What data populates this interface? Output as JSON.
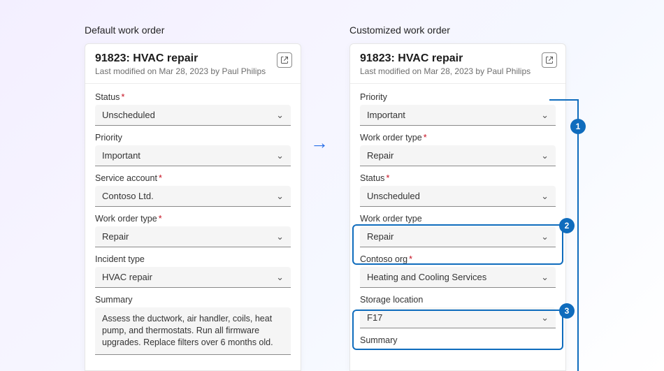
{
  "left": {
    "heading": "Default work order",
    "card": {
      "title": "91823: HVAC repair",
      "subtitle": "Last modified on Mar 28, 2023 by Paul Philips"
    },
    "fields": {
      "status": {
        "label": "Status",
        "required": true,
        "value": "Unscheduled"
      },
      "priority": {
        "label": "Priority",
        "required": false,
        "value": "Important"
      },
      "service_account": {
        "label": "Service account",
        "required": true,
        "value": "Contoso Ltd."
      },
      "work_order_type": {
        "label": "Work order type",
        "required": true,
        "value": "Repair"
      },
      "incident_type": {
        "label": "Incident type",
        "required": false,
        "value": "HVAC repair"
      },
      "summary": {
        "label": "Summary",
        "value": "Assess the ductwork, air handler, coils, heat pump, and thermostats. Run all firmware upgrades. Replace filters over 6 months old."
      }
    }
  },
  "right": {
    "heading": "Customized work order",
    "card": {
      "title": "91823: HVAC repair",
      "subtitle": "Last modified on Mar 28, 2023 by Paul Philips"
    },
    "fields": {
      "priority": {
        "label": "Priority",
        "required": false,
        "value": "Important"
      },
      "work_order_type_req": {
        "label": "Work order type",
        "required": true,
        "value": "Repair"
      },
      "status": {
        "label": "Status",
        "required": true,
        "value": "Unscheduled"
      },
      "work_order_type": {
        "label": "Work order type",
        "required": false,
        "value": "Repair"
      },
      "contoso_org": {
        "label": "Contoso org",
        "required": true,
        "value": "Heating and Cooling Services"
      },
      "storage_location": {
        "label": "Storage location",
        "required": false,
        "value": "F17"
      },
      "summary": {
        "label": "Summary"
      }
    }
  },
  "callouts": {
    "one": "1",
    "two": "2",
    "three": "3"
  }
}
